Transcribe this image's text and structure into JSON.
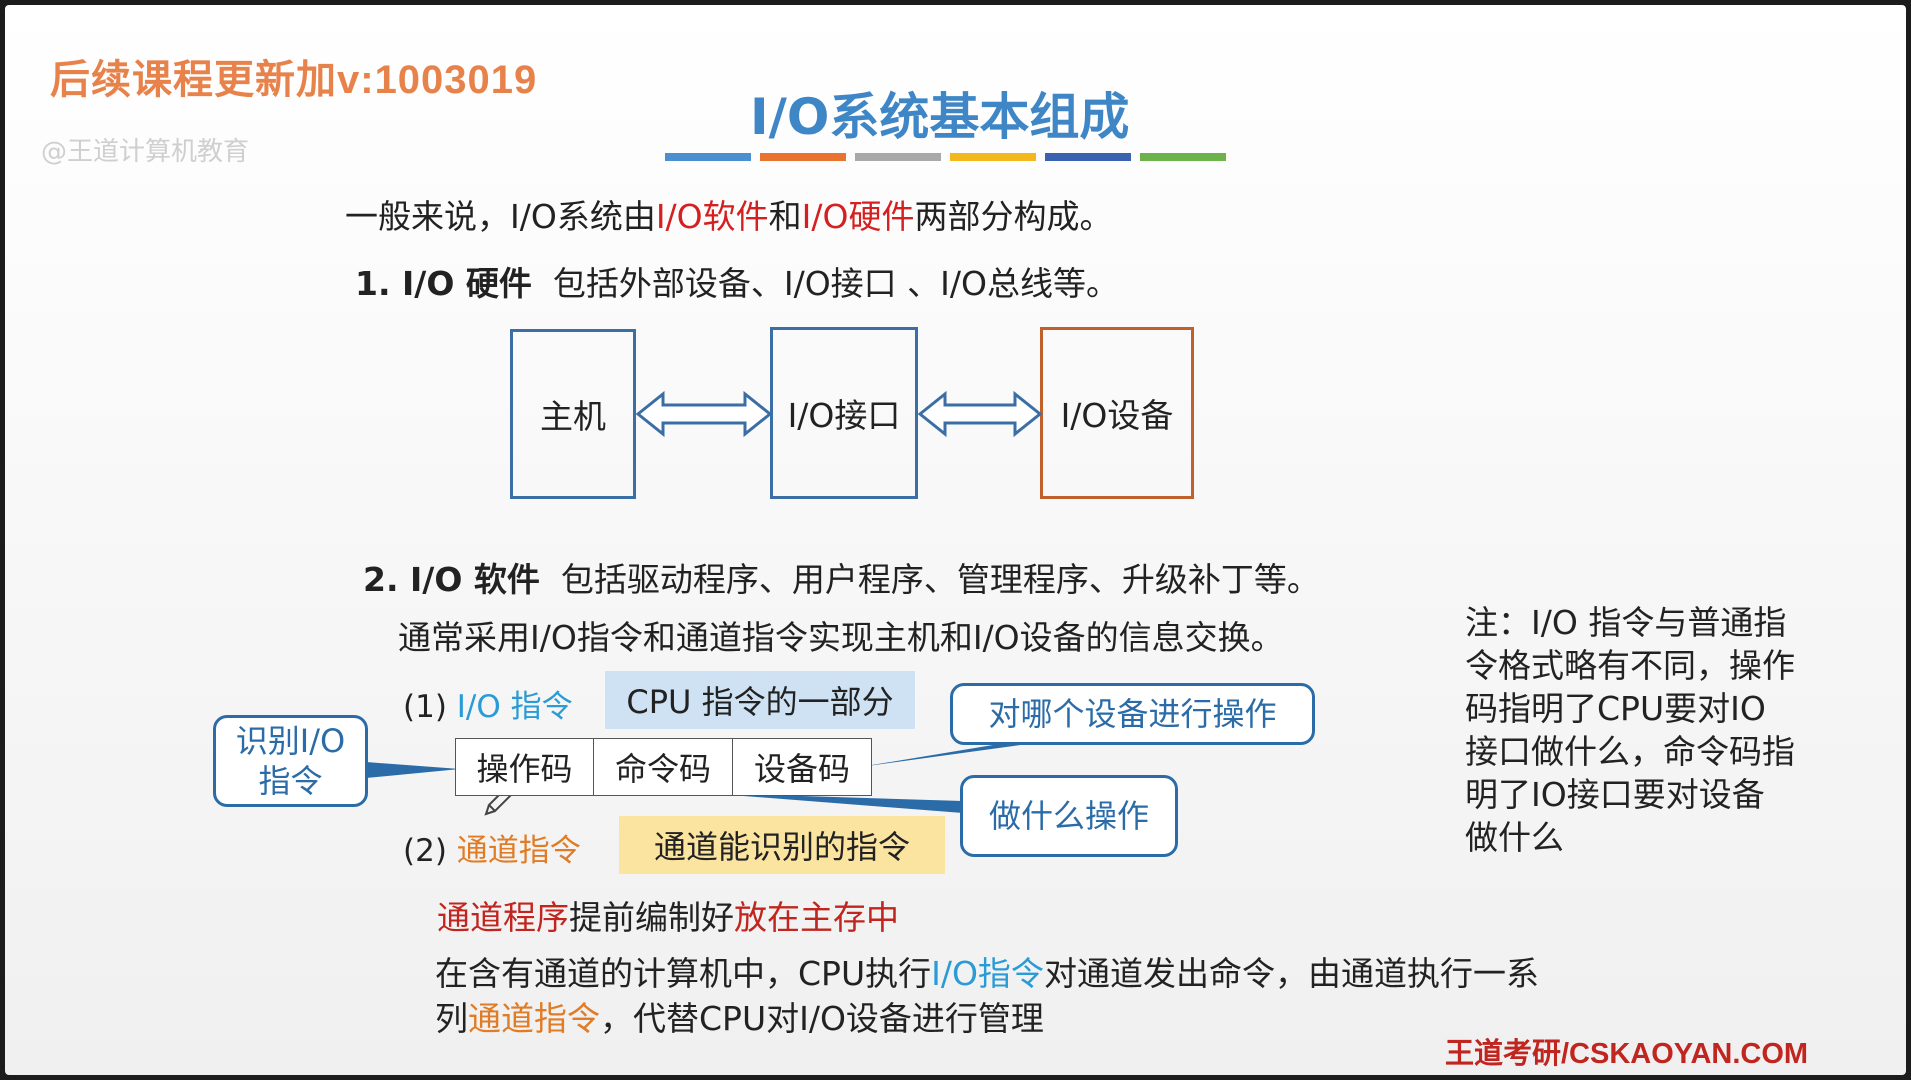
{
  "watermark": {
    "text": "后续课程更新加v:1003019",
    "sub": "@王道计算机教育"
  },
  "title": "I/O系统基本组成",
  "title_bar_colors": [
    "#4a8fd0",
    "#e8742f",
    "#a8a8a8",
    "#f2b81d",
    "#3a62b0",
    "#6cb24a"
  ],
  "intro": {
    "prefix": "一般来说，I/O系统由",
    "software": "I/O软件",
    "and": "和",
    "hardware": "I/O硬件",
    "suffix": "两部分构成。"
  },
  "hardware": {
    "heading": "1. I/O 硬件",
    "desc": "包括外部设备、I/O接口 、I/O总线等。",
    "boxes": [
      "主机",
      "I/O接口",
      "I/O设备"
    ]
  },
  "software": {
    "heading": "2. I/O 软件",
    "desc": "包括驱动程序、用户程序、管理程序、升级补丁等。",
    "line": "通常采用I/O指令和通道指令实现主机和I/O设备的信息交换。"
  },
  "io_instruction": {
    "label_num": "(1)",
    "label": "I/O 指令",
    "highlight": "CPU 指令的一部分",
    "fields": [
      "操作码",
      "命令码",
      "设备码"
    ],
    "callout_identify": "识别I/O 指令",
    "callout_device": "对哪个设备进行操作",
    "callout_operation": "做什么操作"
  },
  "channel_instruction": {
    "label_num": "(2)",
    "label": "通道指令",
    "highlight": "通道能识别的指令",
    "prog_a": "通道程序",
    "prog_b": "提前编制好",
    "prog_c": "放在主存中",
    "exec_a": "在含有通道的计算机中，CPU执行",
    "exec_b": "I/O指令",
    "exec_c": "对通道发出命令，由通道执行一系",
    "exec_d": "列",
    "exec_e": "通道指令",
    "exec_f": "，代替CPU对I/O设备进行管理"
  },
  "note": "注：I/O 指令与普通指令格式略有不同，操作码指明了CPU要对IO接口做什么，命令码指明了IO接口要对设备做什么",
  "footer": "王道考研/CSKAOYAN.COM"
}
